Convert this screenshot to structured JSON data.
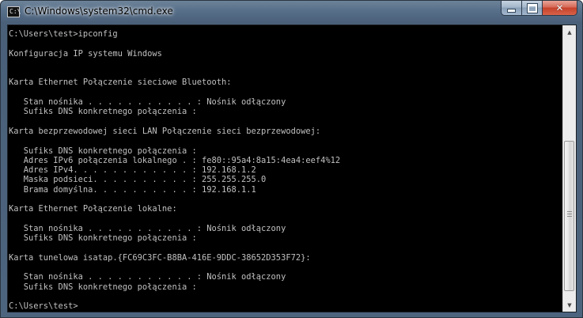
{
  "window": {
    "title": "C:\\Windows\\system32\\cmd.exe",
    "icon": "command-prompt-icon",
    "icon_text": "C:\\",
    "buttons": {
      "minimize": "minimize-icon",
      "maximize": "maximize-icon",
      "close": "close-icon",
      "close_glyph": "✕"
    }
  },
  "console": {
    "lines": [
      "C:\\Users\\test>ipconfig",
      "",
      "Konfiguracja IP systemu Windows",
      "",
      "",
      "Karta Ethernet Połączenie sieciowe Bluetooth:",
      "",
      "   Stan nośnika . . . . . . . . . . . : Nośnik odłączony",
      "   Sufiks DNS konkretnego połączenia :",
      "",
      "Karta bezprzewodowej sieci LAN Połączenie sieci bezprzewodowej:",
      "",
      "   Sufiks DNS konkretnego połączenia :",
      "   Adres IPv6 połączenia lokalnego . : fe80::95a4:8a15:4ea4:eef4%12",
      "   Adres IPv4. . . . . . . . . . . . : 192.168.1.2",
      "   Maska podsieci. . . . . . . . . . : 255.255.255.0",
      "   Brama domyślna. . . . . . . . . . : 192.168.1.1",
      "",
      "Karta Ethernet Połączenie lokalne:",
      "",
      "   Stan nośnika . . . . . . . . . . . : Nośnik odłączony",
      "   Sufiks DNS konkretnego połączenia :",
      "",
      "Karta tunelowa isatap.{FC69C3FC-B8BA-416E-9DDC-38652D353F72}:",
      "",
      "   Stan nośnika . . . . . . . . . . . : Nośnik odłączony",
      "   Sufiks DNS konkretnego połączenia :",
      "",
      "C:\\Users\\test>"
    ]
  },
  "scrollbar": {
    "up_arrow": "▲",
    "down_arrow": "▼",
    "position_fraction": 0.52
  },
  "colors": {
    "console_bg": "#000000",
    "console_text": "#c0c0c0"
  }
}
